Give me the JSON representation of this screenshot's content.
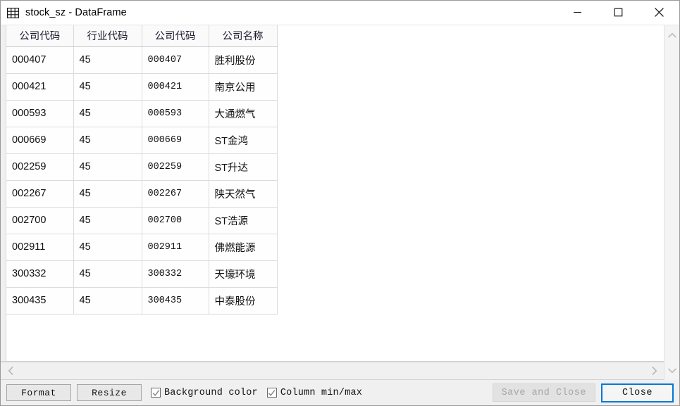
{
  "window": {
    "title": "stock_sz - DataFrame",
    "icon": "table-grid-icon",
    "controls": {
      "minimize": "minimize-icon",
      "maximize": "maximize-icon",
      "close": "close-icon"
    }
  },
  "table": {
    "columns": [
      "公司代码",
      "行业代码",
      "公司代码",
      "公司名称"
    ],
    "rows": [
      {
        "index": "000407",
        "industry_code": "45",
        "company_code": "000407",
        "company_name": "胜利股份"
      },
      {
        "index": "000421",
        "industry_code": "45",
        "company_code": "000421",
        "company_name": "南京公用"
      },
      {
        "index": "000593",
        "industry_code": "45",
        "company_code": "000593",
        "company_name": "大通燃气"
      },
      {
        "index": "000669",
        "industry_code": "45",
        "company_code": "000669",
        "company_name": "ST金鸿"
      },
      {
        "index": "002259",
        "industry_code": "45",
        "company_code": "002259",
        "company_name": "ST升达"
      },
      {
        "index": "002267",
        "industry_code": "45",
        "company_code": "002267",
        "company_name": "陕天然气"
      },
      {
        "index": "002700",
        "industry_code": "45",
        "company_code": "002700",
        "company_name": "ST浩源"
      },
      {
        "index": "002911",
        "industry_code": "45",
        "company_code": "002911",
        "company_name": "佛燃能源"
      },
      {
        "index": "300332",
        "industry_code": "45",
        "company_code": "300332",
        "company_name": "天壕环境"
      },
      {
        "index": "300435",
        "industry_code": "45",
        "company_code": "300435",
        "company_name": "中泰股份"
      }
    ]
  },
  "scrollbars": {
    "vertical": {
      "up_arrow": "chevron-up-icon",
      "down_arrow": "chevron-down-icon"
    },
    "horizontal": {
      "left_arrow": "chevron-left-icon",
      "right_arrow": "chevron-right-icon"
    }
  },
  "toolbar": {
    "format_label": "Format",
    "resize_label": "Resize",
    "background_color_label": "Background color",
    "background_color_checked": true,
    "column_minmax_label": "Column min/max",
    "column_minmax_checked": true,
    "save_and_close_label": "Save and Close",
    "save_and_close_enabled": false,
    "close_label": "Close",
    "close_focused": true
  },
  "colors": {
    "accent": "#0078d7",
    "toolbar_bg": "#f0f0f0",
    "grid_line": "#dcdcdc",
    "header_bg": "#fafafa",
    "disabled_text": "#a6a6a6"
  }
}
